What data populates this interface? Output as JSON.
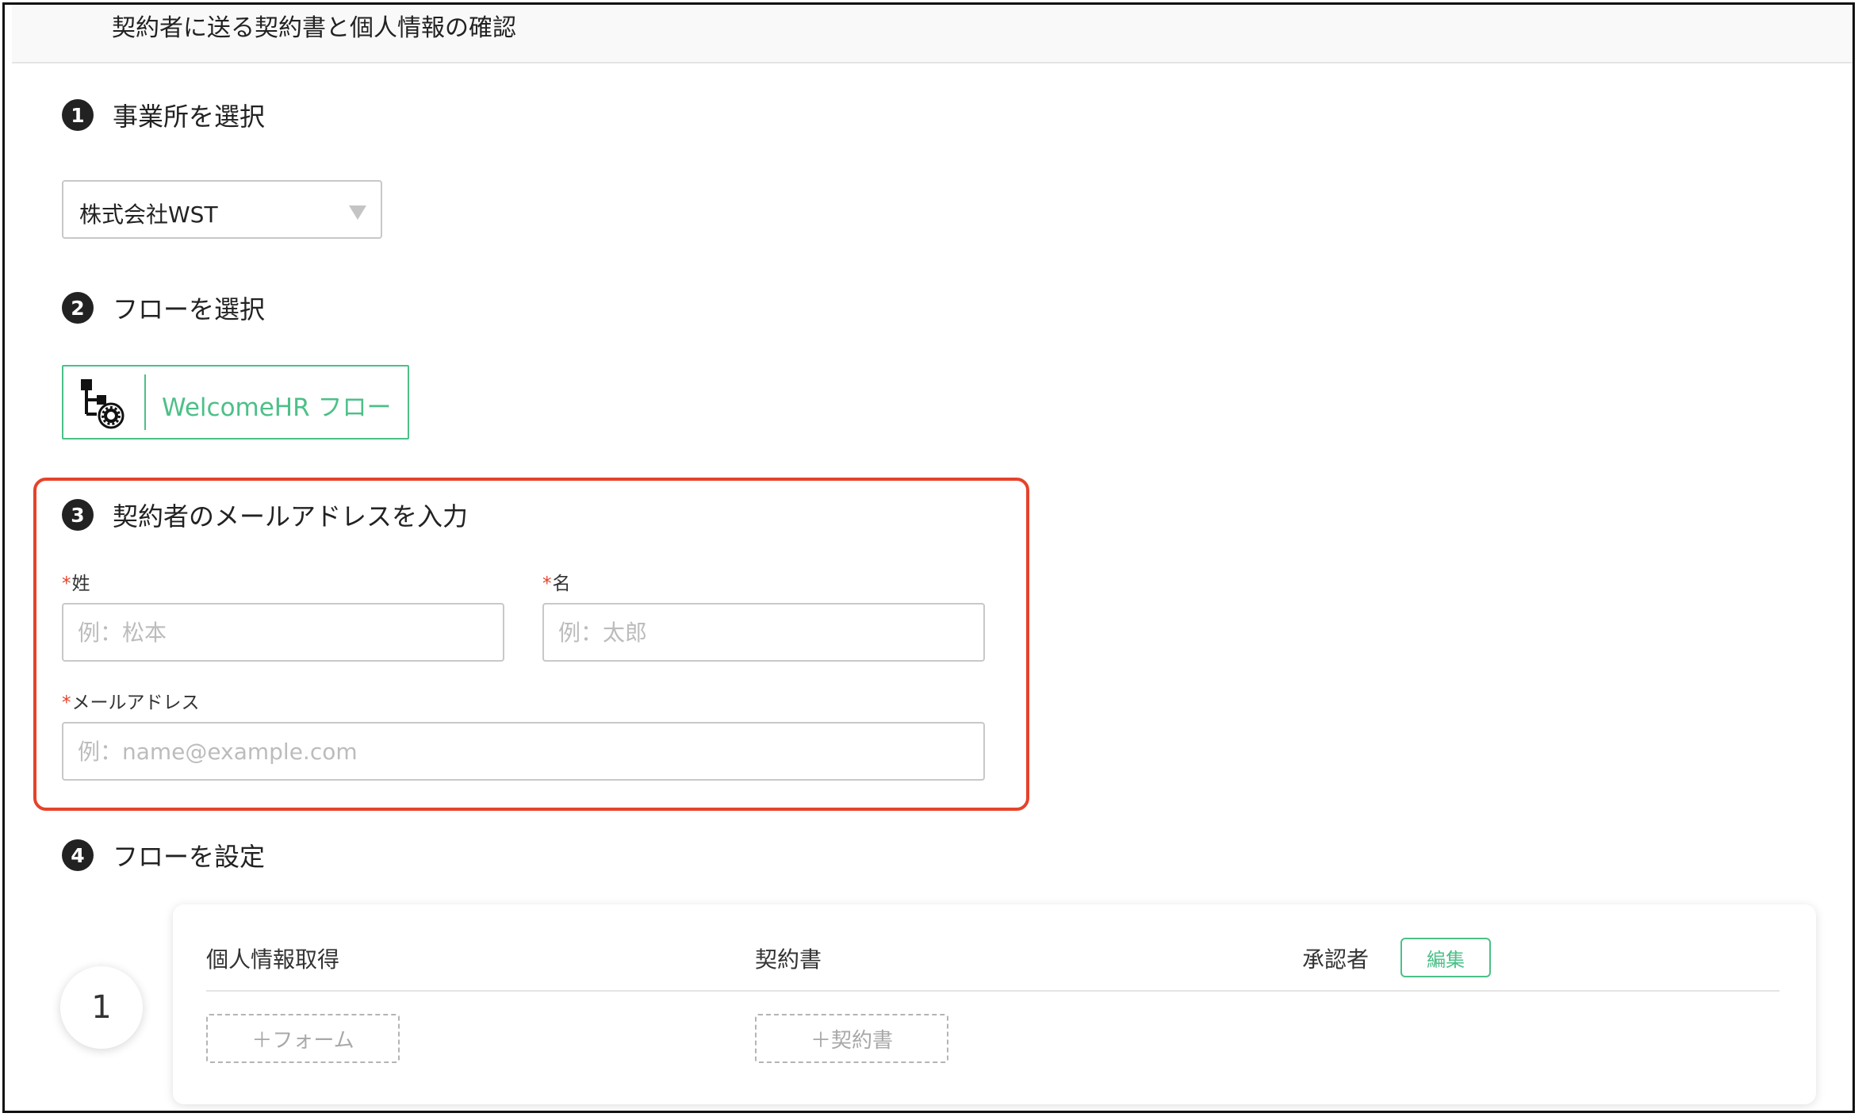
{
  "header": {
    "title": "契約者に送る契約書と個人情報の確認"
  },
  "steps": [
    {
      "number": "1",
      "title": "事業所を選択"
    },
    {
      "number": "2",
      "title": "フローを選択"
    },
    {
      "number": "3",
      "title": "契約者のメールアドレスを入力"
    },
    {
      "number": "4",
      "title": "フローを設定"
    }
  ],
  "office_select": {
    "value": "株式会社WST"
  },
  "flow_select": {
    "label": "WelcomeHR フロー",
    "icon": "flow-gear-icon"
  },
  "form": {
    "required_mark": "*",
    "last_name": {
      "label": "姓",
      "placeholder": "例：松本"
    },
    "first_name": {
      "label": "名",
      "placeholder": "例：太郎"
    },
    "email": {
      "label": "メールアドレス",
      "placeholder": "例：name@example.com"
    }
  },
  "flow_settings": {
    "row_number": "1",
    "columns": {
      "personal_info": "個人情報取得",
      "contract": "契約書",
      "approver": "承認者"
    },
    "edit_label": "編集",
    "add_form_label": "＋フォーム",
    "add_contract_label": "＋契約書"
  },
  "colors": {
    "accent_green": "#4cc088",
    "highlight_red": "#e5432b",
    "required_red": "#e5432b"
  }
}
